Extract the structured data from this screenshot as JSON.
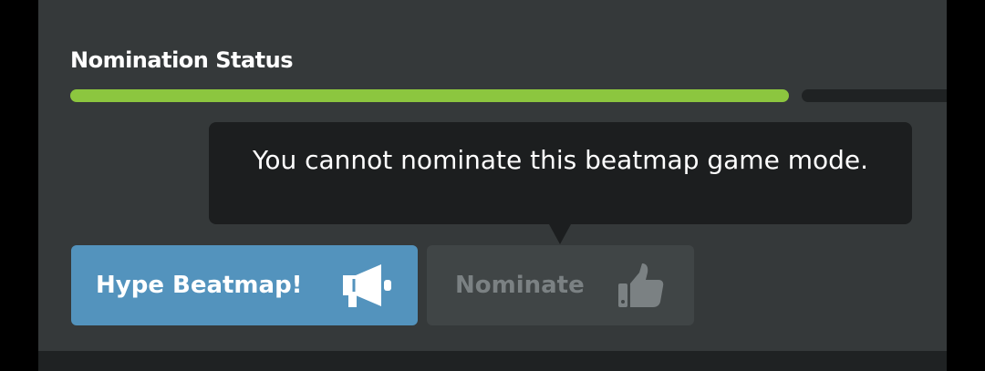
{
  "nomination": {
    "title": "Nomination Status",
    "progress_fraction": 0.82
  },
  "tooltip": {
    "text": "You cannot nominate this beatmap game mode."
  },
  "buttons": {
    "hype_label": "Hype Beatmap!",
    "hype_icon": "megaphone-icon",
    "nominate_label": "Nominate",
    "nominate_icon": "thumbs-up-icon"
  },
  "colors": {
    "progress": "#8cc63f",
    "hype_button": "#5393bd",
    "nominate_button_disabled": "#404546"
  }
}
